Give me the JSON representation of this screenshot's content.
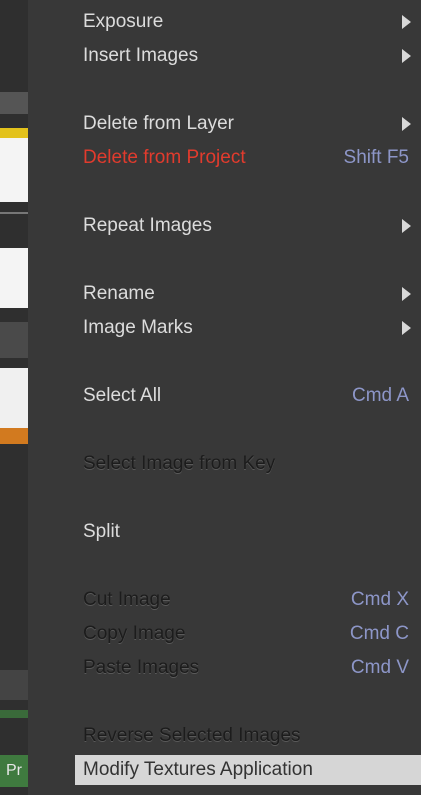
{
  "menu": {
    "items": [
      {
        "label": "Exposure",
        "shortcut": "",
        "submenu": true,
        "style": "normal"
      },
      {
        "label": "Insert Images",
        "shortcut": "",
        "submenu": true,
        "style": "normal"
      },
      {
        "label": "Delete from Layer",
        "shortcut": "",
        "submenu": true,
        "style": "normal"
      },
      {
        "label": "Delete from Project",
        "shortcut": "Shift F5",
        "submenu": false,
        "style": "red"
      },
      {
        "label": "Repeat Images",
        "shortcut": "",
        "submenu": true,
        "style": "normal"
      },
      {
        "label": "Rename",
        "shortcut": "",
        "submenu": true,
        "style": "normal"
      },
      {
        "label": "Image Marks",
        "shortcut": "",
        "submenu": true,
        "style": "normal"
      },
      {
        "label": "Select All",
        "shortcut": "Cmd A",
        "submenu": false,
        "style": "normal"
      },
      {
        "label": "Select Image from Key",
        "shortcut": "",
        "submenu": false,
        "style": "disabled"
      },
      {
        "label": "Split",
        "shortcut": "",
        "submenu": false,
        "style": "normal"
      },
      {
        "label": "Cut Image",
        "shortcut": "Cmd X",
        "submenu": false,
        "style": "disabled"
      },
      {
        "label": "Copy Image",
        "shortcut": "Cmd C",
        "submenu": false,
        "style": "disabled"
      },
      {
        "label": "Paste Images",
        "shortcut": "Cmd V",
        "submenu": false,
        "style": "disabled"
      },
      {
        "label": "Reverse Selected Images",
        "shortcut": "",
        "submenu": false,
        "style": "disabled"
      },
      {
        "label": "Modify Textures Application",
        "shortcut": "",
        "submenu": false,
        "style": "highlight"
      }
    ]
  },
  "background": {
    "bottom_tab_label": "Pr"
  }
}
